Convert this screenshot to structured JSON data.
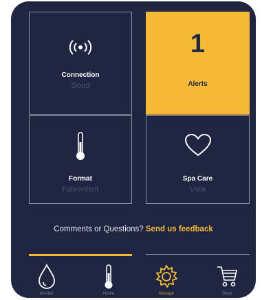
{
  "tiles": {
    "connection": {
      "title": "Connection",
      "status": "Good",
      "icon": "wifi-signal-icon"
    },
    "alerts": {
      "count": "1",
      "title": "Alerts"
    },
    "format": {
      "title": "Format",
      "value": "Fahrenheit",
      "icon": "thermometer-icon"
    },
    "spa_care": {
      "title": "Spa Care",
      "value": "View",
      "icon": "heart-icon"
    }
  },
  "feedback": {
    "prompt": "Comments or Questions? ",
    "link": "Send us feedback"
  },
  "tabbar": {
    "items": [
      {
        "label": "Monitor",
        "icon": "water-drop-icon"
      },
      {
        "label": "Home",
        "icon": "thermometer-icon"
      },
      {
        "label": "Manage",
        "icon": "gear-icon"
      },
      {
        "label": "Shop",
        "icon": "cart-icon"
      }
    ]
  },
  "colors": {
    "background": "#1e2642",
    "accent": "#f5b935",
    "tile_border": "#8a91a6",
    "muted_text": "#4a536e"
  }
}
